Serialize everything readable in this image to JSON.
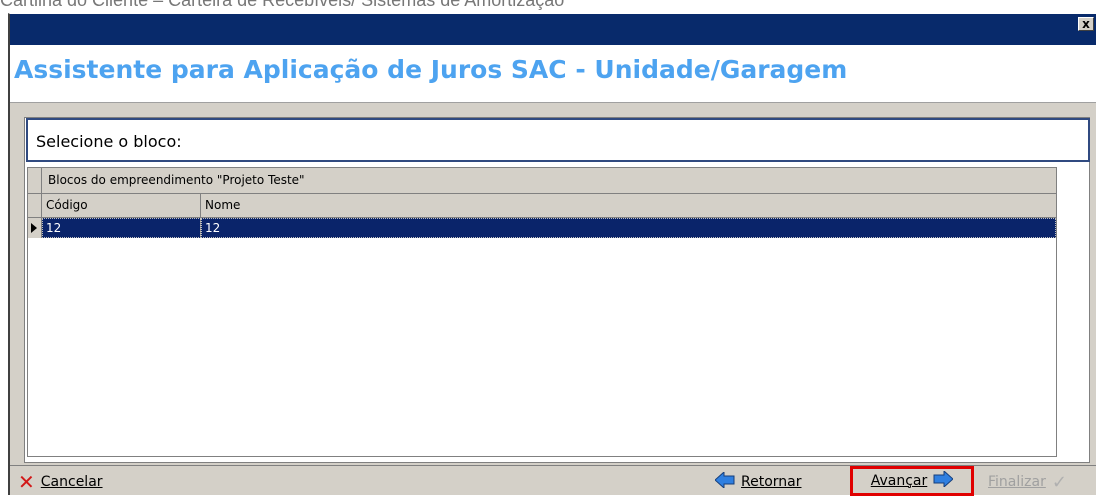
{
  "background_caption": "Cartilha do Cliente – Carteira de Recebíveis/ Sistemas de Amortização",
  "window": {
    "close_label": "x",
    "header_title": "Assistente para Aplicação de Juros SAC - Unidade/Garagem",
    "accent_color": "#4da3f0"
  },
  "prompt": {
    "label": "Selecione o bloco:"
  },
  "grid": {
    "caption": "Blocos do empreendimento \"Projeto Teste\"",
    "columns": [
      "Código",
      "Nome"
    ],
    "rows": [
      {
        "codigo": "12",
        "nome": "12",
        "selected": true
      }
    ]
  },
  "footer": {
    "cancel_label": "Cancelar",
    "back_label": "Retornar",
    "next_label": "Avançar",
    "finish_label": "Finalizar",
    "icons": [
      "close-x-icon",
      "arrow-left-icon",
      "arrow-right-icon",
      "checkmark-icon"
    ]
  }
}
